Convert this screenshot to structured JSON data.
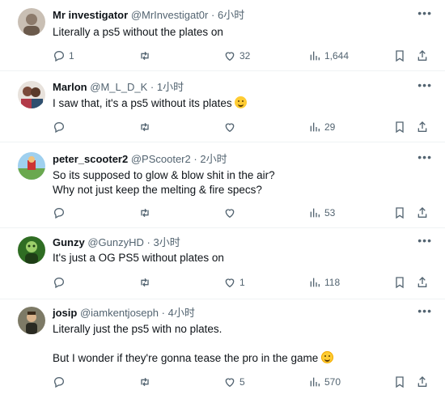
{
  "replies": [
    {
      "name": "Mr investigator",
      "handle": "@MrInvestigat0r",
      "dot": "·",
      "time": "6小时",
      "text": "Literally a ps5 without the plates on",
      "emoji": "",
      "counts": {
        "reply": "1",
        "retweet": "",
        "like": "32",
        "views": "1,644"
      },
      "avatar_color": "#8c7a6b"
    },
    {
      "name": "Marlon",
      "handle": "@M_L_D_K",
      "dot": "·",
      "time": "1小时",
      "text": "I saw that, it's a ps5 without its plates",
      "emoji": "sweat-smile",
      "counts": {
        "reply": "",
        "retweet": "",
        "like": "",
        "views": "29"
      },
      "avatar_color": "#b23a48"
    },
    {
      "name": "peter_scooter2",
      "handle": "@PScooter2",
      "dot": "·",
      "time": "2小时",
      "text": "So its supposed to glow & blow shit in the air?\nWhy not just keep the melting & fire specs?",
      "emoji": "",
      "counts": {
        "reply": "",
        "retweet": "",
        "like": "",
        "views": "53"
      },
      "avatar_color": "#6aa84f"
    },
    {
      "name": "Gunzy",
      "handle": "@GunzyHD",
      "dot": "·",
      "time": "3小时",
      "text": "It's just a OG PS5 without plates on",
      "emoji": "",
      "counts": {
        "reply": "",
        "retweet": "",
        "like": "1",
        "views": "118"
      },
      "avatar_color": "#3d7a2e"
    },
    {
      "name": "josip",
      "handle": "@iamkentjoseph",
      "dot": "·",
      "time": "4小时",
      "text": "Literally just the ps5 with no plates.\n\nBut I wonder if they're gonna tease the pro in the game",
      "emoji": "tears-of-joy",
      "counts": {
        "reply": "",
        "retweet": "",
        "like": "5",
        "views": "570"
      },
      "avatar_color": "#4a4a3a"
    }
  ],
  "icons": {
    "more": "more-icon",
    "reply": "reply-icon",
    "retweet": "retweet-icon",
    "like": "like-icon",
    "views": "views-icon",
    "bookmark": "bookmark-icon",
    "share": "share-icon"
  },
  "colors": {
    "text": "#0f1419",
    "secondary": "#536471",
    "divider": "#eff3f4"
  }
}
